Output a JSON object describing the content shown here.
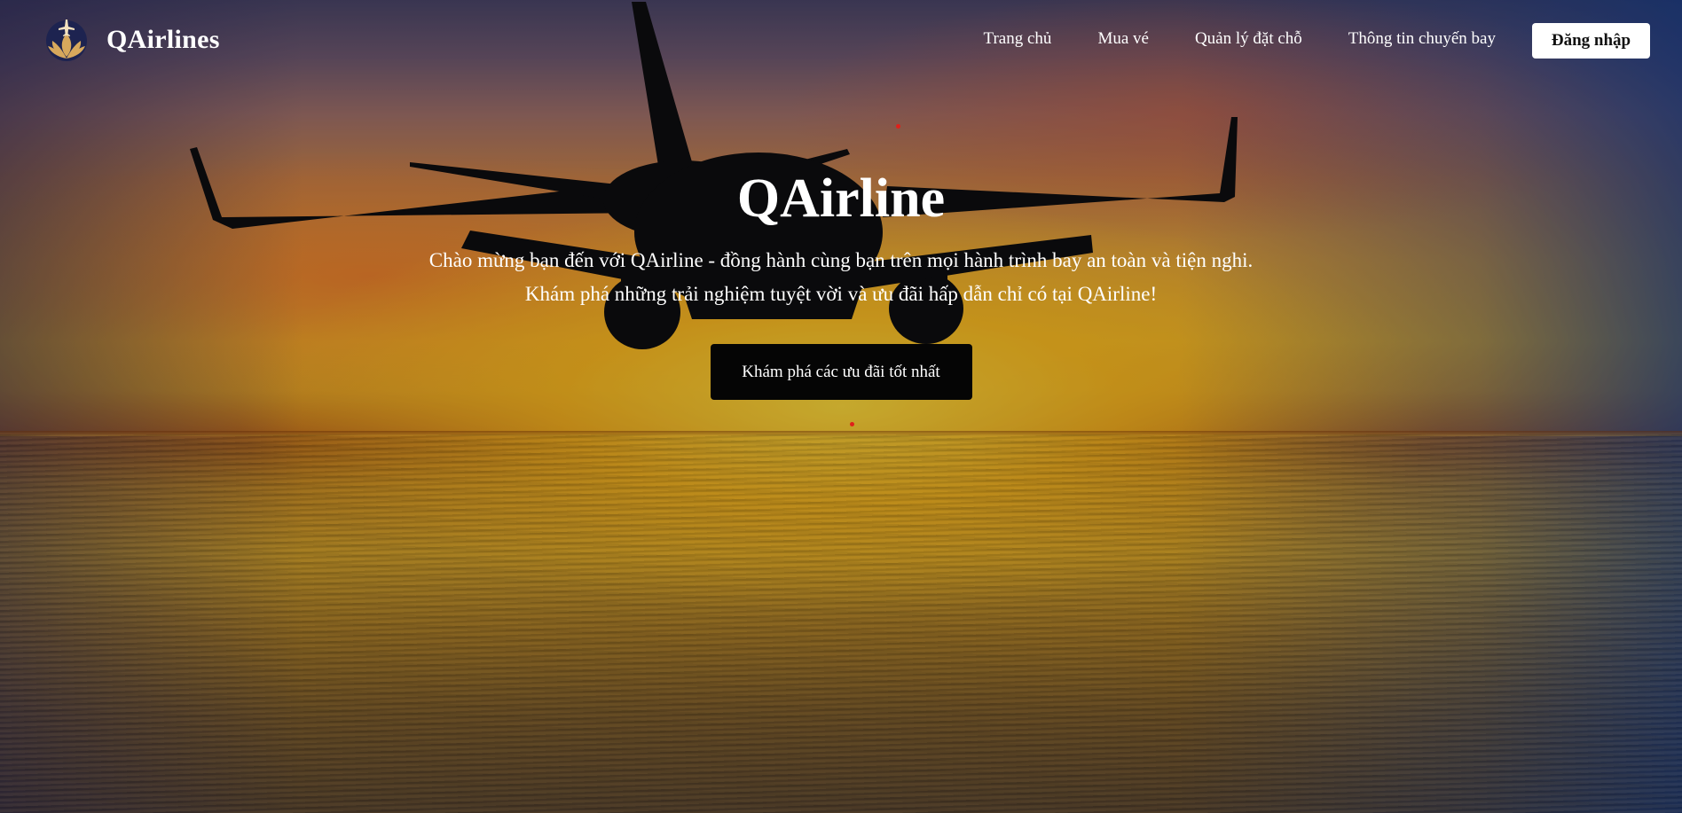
{
  "brand": {
    "name": "QAirlines",
    "logo_icon": "lotus-plane-logo-icon"
  },
  "nav": {
    "items": [
      {
        "label": "Trang chủ"
      },
      {
        "label": "Mua vé"
      },
      {
        "label": "Quản lý đặt chỗ"
      },
      {
        "label": "Thông tin chuyến bay"
      }
    ],
    "login_label": "Đăng nhập"
  },
  "hero": {
    "title": "QAirline",
    "subtitle_line1": "Chào mừng bạn đến với QAirline - đồng hành cùng bạn trên mọi hành trình bay an toàn và tiện nghi.",
    "subtitle_line2": "Khám phá những trải nghiệm tuyệt vời và ưu đãi hấp dẫn chỉ có tại QAirline!",
    "cta_label": "Khám phá các ưu đãi tốt nhất",
    "background": "airplane-over-sunset-sea"
  },
  "colors": {
    "login_bg": "#ffffff",
    "cta_bg": "#050505",
    "text": "#ffffff"
  }
}
